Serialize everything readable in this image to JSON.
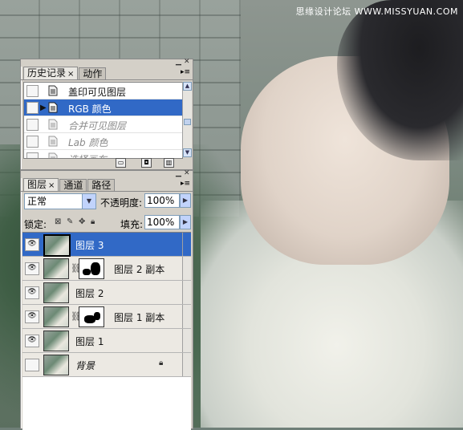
{
  "watermark": "思缘设计论坛 WWW.MISSYUAN.COM",
  "history_panel": {
    "tabs": [
      {
        "label": "历史记录",
        "active": true,
        "close": "×"
      },
      {
        "label": "动作",
        "active": false
      }
    ],
    "items": [
      {
        "label": "盖印可见图层",
        "selected": false,
        "dimmed": false
      },
      {
        "label": "RGB 颜色",
        "selected": true,
        "dimmed": false
      },
      {
        "label": "合并可见图层",
        "selected": false,
        "dimmed": true
      },
      {
        "label": "Lab 颜色",
        "selected": false,
        "dimmed": true
      },
      {
        "label": "选择画布",
        "selected": false,
        "dimmed": true
      }
    ]
  },
  "layers_panel": {
    "tabs": [
      {
        "label": "图层",
        "active": true,
        "close": "×"
      },
      {
        "label": "通道",
        "active": false
      },
      {
        "label": "路径",
        "active": false
      }
    ],
    "blend_mode": "正常",
    "opacity_label": "不透明度:",
    "opacity_value": "100%",
    "lock_label": "锁定:",
    "fill_label": "填充:",
    "fill_value": "100%",
    "layers": [
      {
        "name": "图层 3",
        "selected": true,
        "has_mask": false
      },
      {
        "name": "图层 2 副本",
        "selected": false,
        "has_mask": true
      },
      {
        "name": "图层 2",
        "selected": false,
        "has_mask": false
      },
      {
        "name": "图层 1 副本",
        "selected": false,
        "has_mask": true
      },
      {
        "name": "图层 1",
        "selected": false,
        "has_mask": false
      },
      {
        "name": "背景",
        "selected": false,
        "has_mask": false,
        "locked": true
      }
    ]
  }
}
